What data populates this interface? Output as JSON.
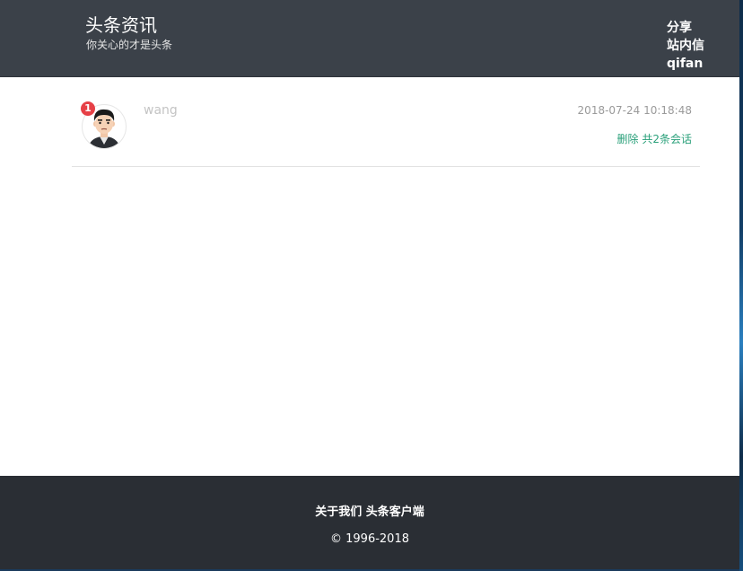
{
  "header": {
    "title": "头条资讯",
    "subtitle": "你关心的才是头条",
    "nav": {
      "share": "分享",
      "messages": "站内信",
      "user": "qifan"
    }
  },
  "conversation": {
    "unread_count": "1",
    "avatar_icon": "user-avatar-icon",
    "username": "wang",
    "timestamp": "2018-07-24 10:18:48",
    "delete_label": "删除",
    "count_label": "共2条会话"
  },
  "footer": {
    "about": "关于我们",
    "client": "头条客户端",
    "copyright": "© 1996-2018"
  },
  "colors": {
    "header_bg": "#3b4149",
    "footer_bg": "#2a2e34",
    "badge": "#e64046",
    "action_link": "#2aa07a"
  }
}
